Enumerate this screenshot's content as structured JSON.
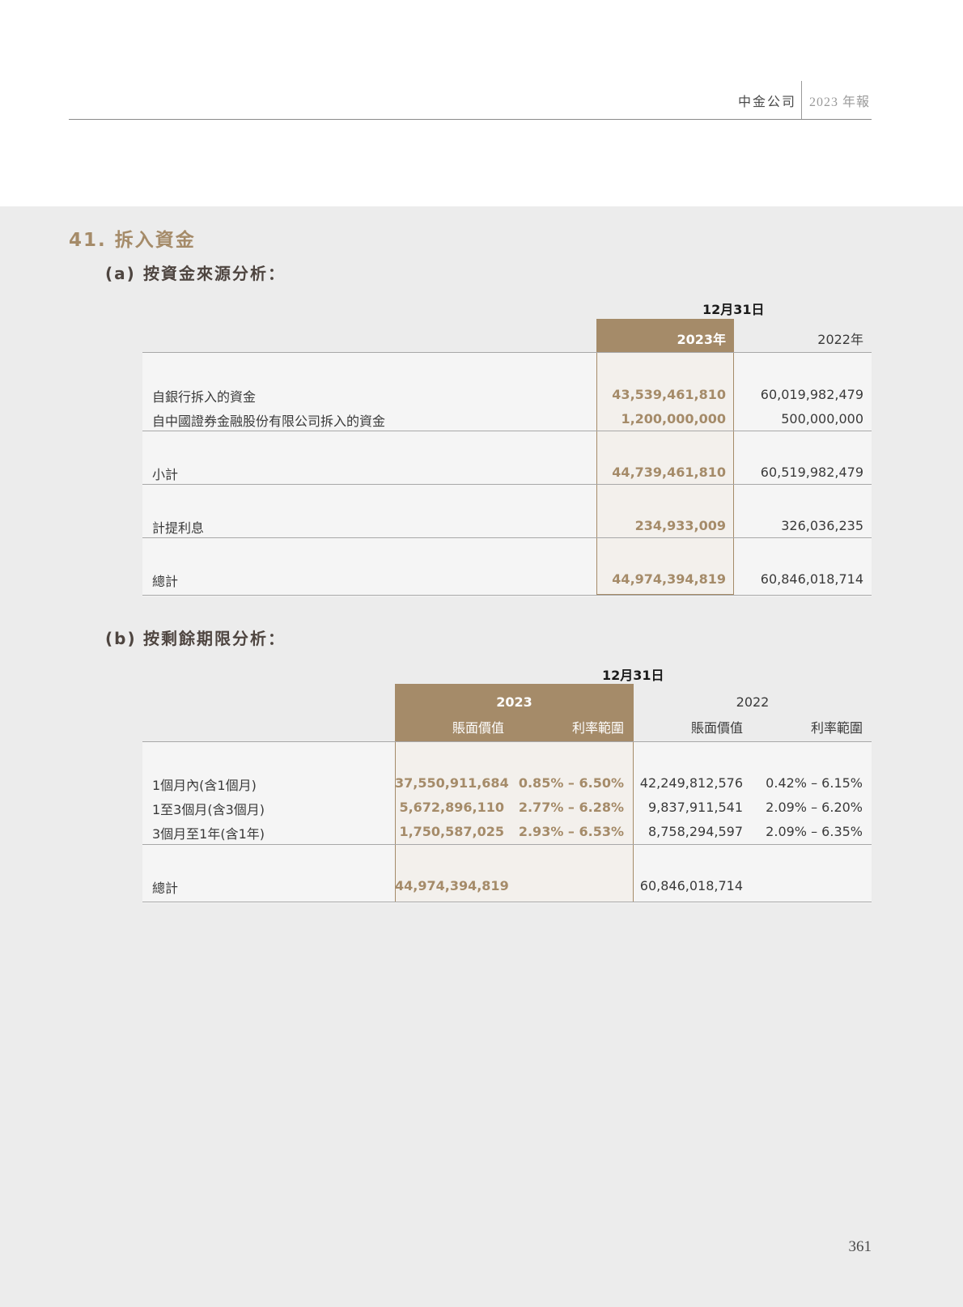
{
  "header": {
    "company": "中金公司",
    "report": "2023 年報"
  },
  "section": {
    "number": "41.",
    "title": "拆入資金"
  },
  "part_a": {
    "label": "(a)",
    "title": "按資金來源分析：",
    "date_label": "12月31日",
    "col_2023": "2023年",
    "col_2022": "2022年",
    "rows": [
      {
        "label": "自銀行拆入的資金",
        "v2023": "43,539,461,810",
        "v2022": "60,019,982,479"
      },
      {
        "label": "自中國證券金融股份有限公司拆入的資金",
        "v2023": "1,200,000,000",
        "v2022": "500,000,000"
      }
    ],
    "subtotal": {
      "label": "小計",
      "v2023": "44,739,461,810",
      "v2022": "60,519,982,479"
    },
    "interest": {
      "label": "計提利息",
      "v2023": "234,933,009",
      "v2022": "326,036,235"
    },
    "total": {
      "label": "總計",
      "v2023": "44,974,394,819",
      "v2022": "60,846,018,714"
    }
  },
  "part_b": {
    "label": "(b)",
    "title": "按剩餘期限分析：",
    "date_label": "12月31日",
    "year_2023": "2023",
    "year_2022": "2022",
    "col_book": "賬面價值",
    "col_rate": "利率範圍",
    "rows": [
      {
        "label": "1個月內(含1個月)",
        "book2023": "37,550,911,684",
        "rate2023": "0.85% – 6.50%",
        "book2022": "42,249,812,576",
        "rate2022": "0.42% – 6.15%"
      },
      {
        "label": "1至3個月(含3個月)",
        "book2023": "5,672,896,110",
        "rate2023": "2.77% – 6.28%",
        "book2022": "9,837,911,541",
        "rate2022": "2.09% – 6.20%"
      },
      {
        "label": "3個月至1年(含1年)",
        "book2023": "1,750,587,025",
        "rate2023": "2.93% – 6.53%",
        "book2022": "8,758,294,597",
        "rate2022": "2.09% – 6.35%"
      }
    ],
    "total": {
      "label": "總計",
      "book2023": "44,974,394,819",
      "book2022": "60,846,018,714"
    }
  },
  "page_number": "361"
}
